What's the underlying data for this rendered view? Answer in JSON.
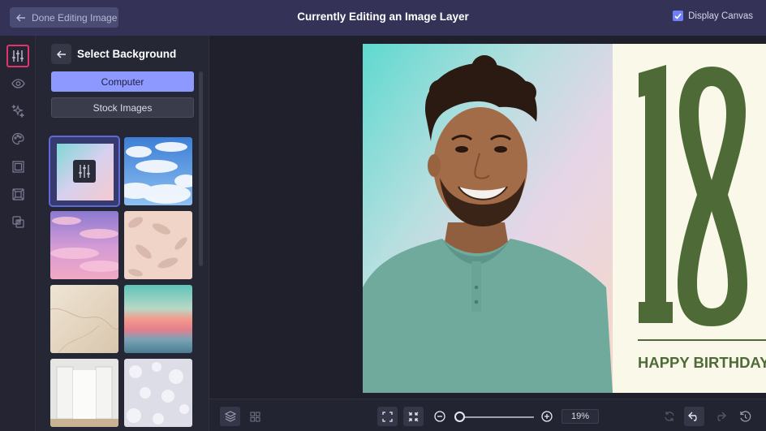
{
  "header": {
    "done_label": "Done Editing Image",
    "title": "Currently Editing an Image Layer",
    "display_canvas_label": "Display Canvas",
    "display_canvas_checked": true
  },
  "sidebar_rail": {
    "icons": [
      "adjust-icon",
      "eye-icon",
      "sparkle-icon",
      "palette-icon",
      "frame-icon",
      "crop-icon",
      "layers-overlap-icon"
    ],
    "active": "adjust-icon"
  },
  "panel": {
    "title": "Select Background",
    "computer_label": "Computer",
    "stock_label": "Stock Images",
    "thumbnails": [
      "custom-gradient",
      "blue-sky-clouds",
      "pink-sunset-clouds",
      "leaf-shadows",
      "marble",
      "ocean-sunset",
      "white-doorway",
      "bokeh-lights"
    ],
    "selected_thumbnail": "custom-gradient"
  },
  "canvas": {
    "big_number": "18",
    "greeting": "HAPPY BIRTHDAY"
  },
  "toolbar": {
    "zoom_level": "19%"
  },
  "colors": {
    "topbar": "#343357",
    "accent": "#8d99ff",
    "card_green": "#4e6b37",
    "card_bg": "#faf8e9",
    "active_outline": "#e0356a"
  }
}
